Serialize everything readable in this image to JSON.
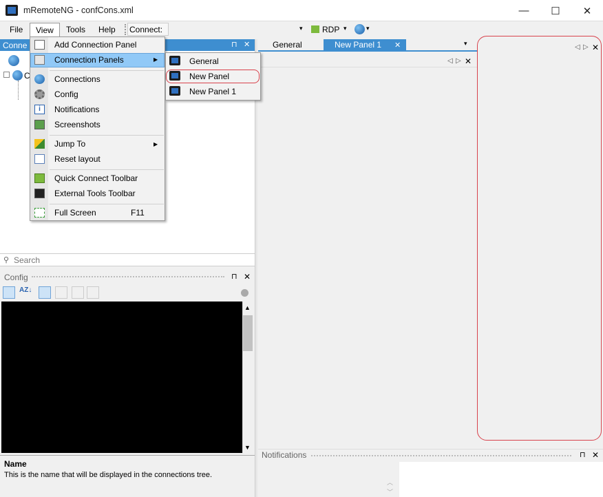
{
  "window": {
    "title": "mRemoteNG - confCons.xml",
    "minimize": "—",
    "maximize": "☐",
    "close": "✕"
  },
  "menubar": {
    "file": "File",
    "view": "View",
    "tools": "Tools",
    "help": "Help",
    "connect": "Connect:"
  },
  "quick_connect": {
    "protocol": "RDP",
    "dropdown": "▾"
  },
  "connections_panel": {
    "title": "Conne",
    "pin": "⊓",
    "close": "✕",
    "tree_root": "C"
  },
  "search": {
    "placeholder": "Search"
  },
  "config_panel": {
    "title": "Config",
    "pin": "⊓",
    "close": "✕"
  },
  "description": {
    "name": "Name",
    "text": "This is the name that will be displayed in the connections tree."
  },
  "doc_tabs": {
    "tabs": [
      "General",
      "New Panel 1"
    ],
    "active_close": "✕",
    "dropdown": "▾"
  },
  "doc_controls": {
    "left": "◁",
    "right": "▷",
    "close": "✕"
  },
  "notifications": {
    "title": "Notifications",
    "pin": "⊓",
    "close": "✕"
  },
  "view_menu": {
    "items": [
      {
        "label": "Add Connection Panel",
        "icon": "add-panel-icon"
      },
      {
        "label": "Connection Panels",
        "icon": "panels-icon",
        "submenu": true
      },
      {
        "label": "Connections",
        "icon": "globe-icon"
      },
      {
        "label": "Config",
        "icon": "gear-icon"
      },
      {
        "label": "Notifications",
        "icon": "info-icon"
      },
      {
        "label": "Screenshots",
        "icon": "image-icon"
      },
      {
        "label": "Jump To",
        "icon": "jump-icon",
        "submenu": true
      },
      {
        "label": "Reset layout",
        "icon": "layout-icon"
      },
      {
        "label": "Quick Connect Toolbar",
        "icon": "quick-connect-icon"
      },
      {
        "label": "External Tools Toolbar",
        "icon": "terminal-icon"
      },
      {
        "label": "Full Screen",
        "icon": "fullscreen-icon",
        "shortcut": "F11"
      }
    ],
    "arrow": "▶"
  },
  "sub_menu": {
    "items": [
      "General",
      "New Panel",
      "New Panel 1"
    ]
  },
  "colors": {
    "accent": "#3e8ed0",
    "highlight": "#91c9f7",
    "annotation": "#d8414b"
  }
}
